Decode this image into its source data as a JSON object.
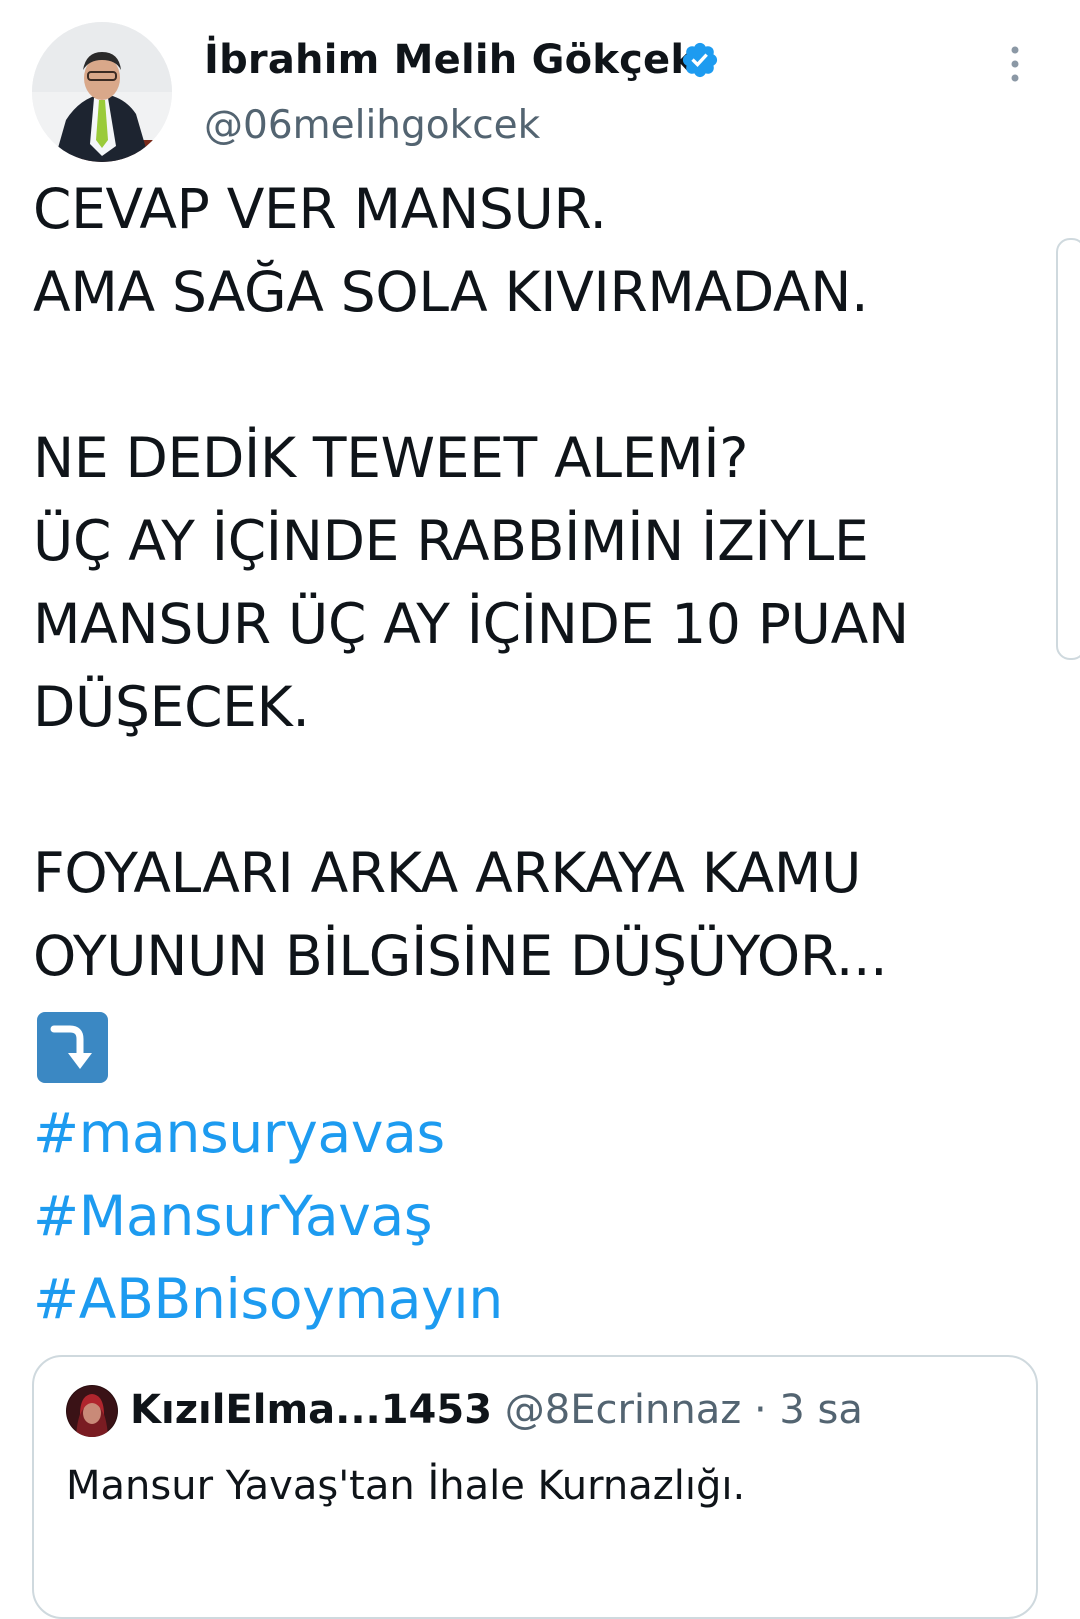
{
  "tweet": {
    "author": {
      "display_name": "İbrahim Melih Gökçek",
      "handle": "@06melihgokcek",
      "verified_icon": "verified-badge-icon"
    },
    "menu_icon": "more-vertical-icon",
    "lines": [
      "CEVAP VER MANSUR.",
      "AMA SAĞA SOLA KIVIRMADAN.",
      "",
      "NE DEDİK TEWEET ALEMİ?",
      "ÜÇ AY İÇİNDE RABBİMİN İZİYLE",
      "MANSUR ÜÇ AY İÇİNDE 10 PUAN",
      "DÜŞECEK.",
      "",
      "FOYALARI ARKA ARKAYA KAMU",
      "OYUNUN BİLGİSİNE DÜŞÜYOR..."
    ],
    "emoji": "right-arrow-curving-down-emoji",
    "hashtags": [
      "#mansuryavas",
      "#MansurYavaş",
      "#ABBnisoymayın"
    ]
  },
  "quoted_tweet": {
    "display_name": "KızılElma...1453",
    "handle": "@8Ecrinnaz",
    "separator": "·",
    "time": "3 sa",
    "text": "Mansur Yavaş'tan İhale Kurnazlığı."
  },
  "colors": {
    "text": "#0f1419",
    "secondary": "#536471",
    "link": "#1d9bf0",
    "border": "#cfd9de"
  }
}
